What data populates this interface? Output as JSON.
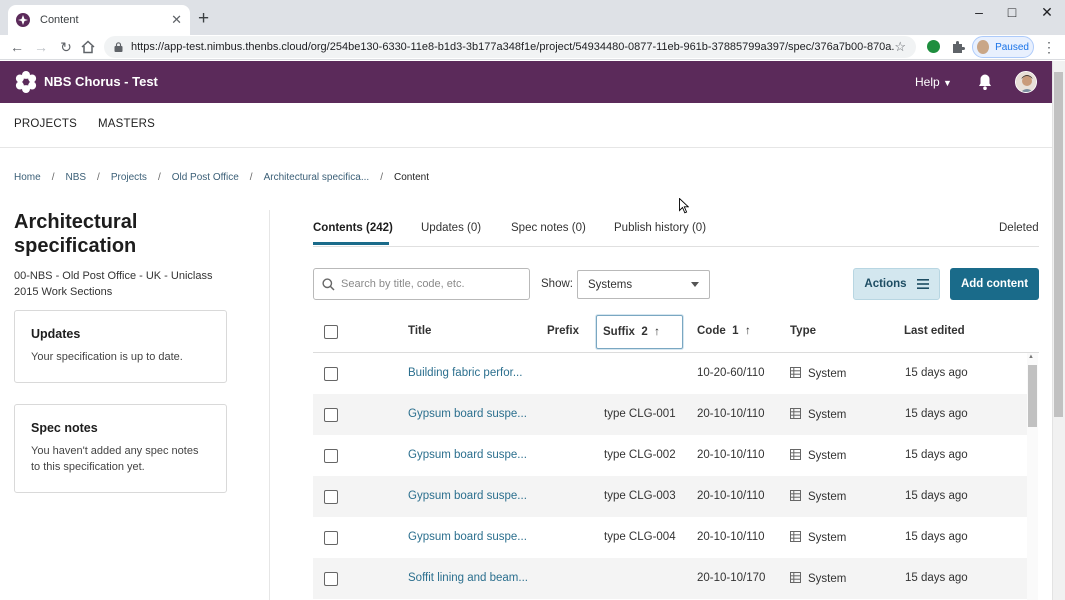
{
  "browser": {
    "tab_title": "Content",
    "url": "https://app-test.nimbus.thenbs.cloud/org/254be130-6330-11e8-b1d3-3b177a348f1e/project/54934480-0877-11eb-961b-37885799a397/spec/376a7b00-870a...",
    "profile_status": "Paused",
    "new_tab": "+",
    "close_tab": "✕"
  },
  "app": {
    "brand": "NBS Chorus - Test",
    "help_label": "Help",
    "colors": {
      "header": "#5b2a5a",
      "primary": "#1a6b8a",
      "link": "#2b6f8e"
    }
  },
  "topnav": {
    "projects": "PROJECTS",
    "masters": "MASTERS"
  },
  "breadcrumb": {
    "items": [
      "Home",
      "NBS",
      "Projects",
      "Old Post Office",
      "Architectural specifica..."
    ],
    "current": "Content",
    "separator": "/"
  },
  "spec": {
    "title": "Architectural specification",
    "subtitle": "00-NBS - Old Post Office - UK - Uniclass 2015 Work Sections"
  },
  "updates_card": {
    "heading": "Updates",
    "text": "Your specification is up to date."
  },
  "notes_card": {
    "heading": "Spec notes",
    "text": "You haven't added any spec notes to this specification yet."
  },
  "tabs": {
    "contents": "Contents (242)",
    "updates": "Updates (0)",
    "spec_notes": "Spec notes (0)",
    "publish_history": "Publish history (0)",
    "deleted": "Deleted"
  },
  "filters": {
    "search_placeholder": "Search by title, code, etc.",
    "show_label": "Show:",
    "show_value": "Systems",
    "actions_label": "Actions",
    "add_label": "Add content"
  },
  "table": {
    "headers": {
      "title": "Title",
      "prefix": "Prefix",
      "suffix": "Suffix",
      "suffix_sort": "2",
      "code": "Code",
      "code_sort": "1",
      "type": "Type",
      "last_edited": "Last edited"
    },
    "rows": [
      {
        "title": "Building fabric perfor...",
        "suffix": "",
        "code": "10-20-60/110",
        "type": "System",
        "edited": "15 days ago"
      },
      {
        "title": "Gypsum board suspe...",
        "suffix": "type CLG-001",
        "code": "20-10-10/110",
        "type": "System",
        "edited": "15 days ago"
      },
      {
        "title": "Gypsum board suspe...",
        "suffix": "type CLG-002",
        "code": "20-10-10/110",
        "type": "System",
        "edited": "15 days ago"
      },
      {
        "title": "Gypsum board suspe...",
        "suffix": "type CLG-003",
        "code": "20-10-10/110",
        "type": "System",
        "edited": "15 days ago"
      },
      {
        "title": "Gypsum board suspe...",
        "suffix": "type CLG-004",
        "code": "20-10-10/110",
        "type": "System",
        "edited": "15 days ago"
      },
      {
        "title": "Soffit lining and beam...",
        "suffix": "",
        "code": "20-10-10/170",
        "type": "System",
        "edited": "15 days ago"
      }
    ]
  }
}
